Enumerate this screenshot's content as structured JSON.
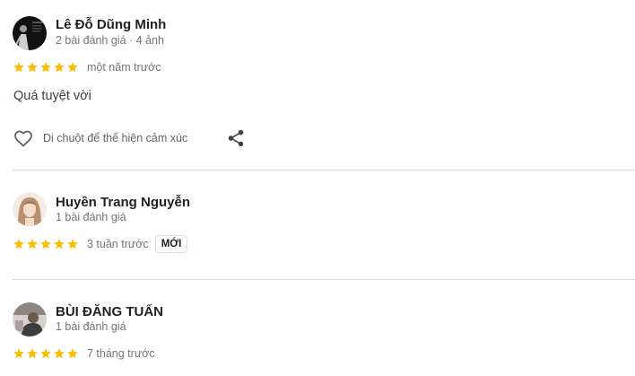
{
  "reviews": [
    {
      "author": "Lê Đỗ Dũng Minh",
      "meta": "2 bài đánh giá · 4 ảnh",
      "rating": 5,
      "time": "một năm trước",
      "text": "Quá tuyệt vời",
      "reaction_label": "Di chuột để thể hiện cảm xúc"
    },
    {
      "author": "Huyền Trang Nguyễn",
      "meta": "1 bài đánh giá",
      "rating": 5,
      "time": "3 tuần trước",
      "badge": "MỚI"
    },
    {
      "author": "BÙI ĐĂNG TUẤN",
      "meta": "1 bài đánh giá",
      "rating": 5,
      "time": "7 tháng trước"
    }
  ],
  "icons": {
    "star": "star-icon",
    "heart": "heart-outline-icon",
    "share": "share-icon"
  },
  "colors": {
    "star": "#fbbc04",
    "secondary_text": "#70757a",
    "divider": "#dadce0"
  }
}
